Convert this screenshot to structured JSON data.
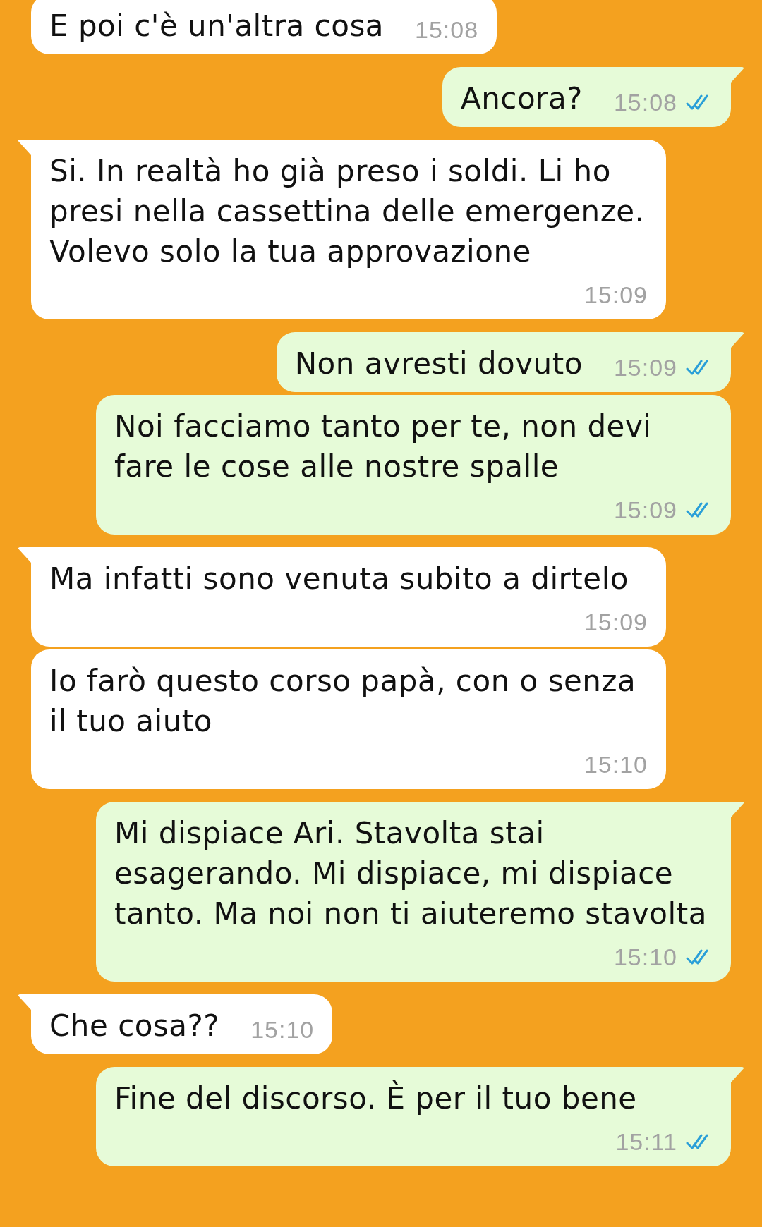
{
  "messages": [
    {
      "kind": "in",
      "tail": false,
      "text": "E poi c'è un'altra cosa",
      "time": "15:08"
    },
    {
      "kind": "out",
      "tail": true,
      "text": "Ancora?",
      "time": "15:08",
      "read": true
    },
    {
      "kind": "in",
      "tail": true,
      "text": "Si. In realtà ho già preso i soldi. Li ho presi nella cassettina delle emergenze. Volevo solo la tua approvazione",
      "time": "15:09"
    },
    {
      "kind": "out",
      "tail": true,
      "text": "Non avresti dovuto",
      "time": "15:09",
      "read": true
    },
    {
      "kind": "out",
      "tail": false,
      "text": "Noi facciamo tanto per te, non devi fare le cose alle nostre spalle",
      "time": "15:09",
      "read": true
    },
    {
      "kind": "in",
      "tail": true,
      "text": "Ma infatti sono venuta subito a dirtelo",
      "time": "15:09"
    },
    {
      "kind": "in",
      "tail": false,
      "text": "Io farò questo corso papà, con o senza il tuo aiuto",
      "time": "15:10"
    },
    {
      "kind": "out",
      "tail": true,
      "text": "Mi dispiace Ari. Stavolta stai esagerando. Mi dispiace, mi dispiace tanto. Ma noi non ti aiuteremo stavolta",
      "time": "15:10",
      "read": true
    },
    {
      "kind": "in",
      "tail": true,
      "text": "Che cosa??",
      "time": "15:10"
    },
    {
      "kind": "out",
      "tail": true,
      "text": "Fine del discorso. È per il tuo bene",
      "time": "15:11",
      "read": true
    }
  ]
}
